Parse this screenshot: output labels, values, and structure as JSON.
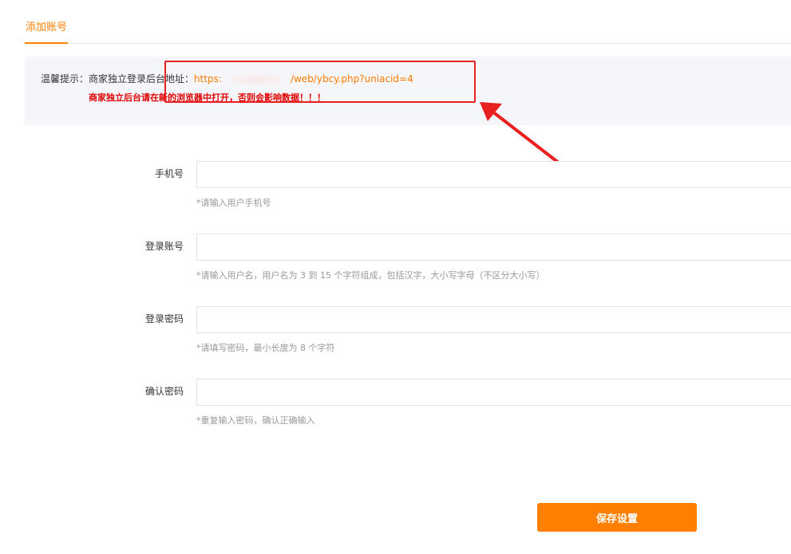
{
  "tabs": [
    {
      "label": "添加账号",
      "active": true
    }
  ],
  "tip": {
    "label": "温馨提示：商家独立登录后台地址：",
    "url_prefix": "https:",
    "url_suffix": "/web/ybcy.php?uniacid=4",
    "warning": "商家独立后台请在新的浏览器中打开，否则会影响数据！！！"
  },
  "form": {
    "fields": [
      {
        "label": "手机号",
        "value": "",
        "help": "*请输入用户手机号"
      },
      {
        "label": "登录账号",
        "value": "",
        "help": "*请输入用户名，用户名为 3 到 15 个字符组成，包括汉字，大小写字母（不区分大小写）"
      },
      {
        "label": "登录密码",
        "value": "",
        "help": "*请填写密码，最小长度为 8 个字符"
      },
      {
        "label": "确认密码",
        "value": "",
        "help": "*重复输入密码，确认正确输入"
      }
    ],
    "save_label": "保存设置"
  },
  "colors": {
    "accent": "#ff8000",
    "annotation": "#e82020",
    "warning": "#e00000"
  }
}
